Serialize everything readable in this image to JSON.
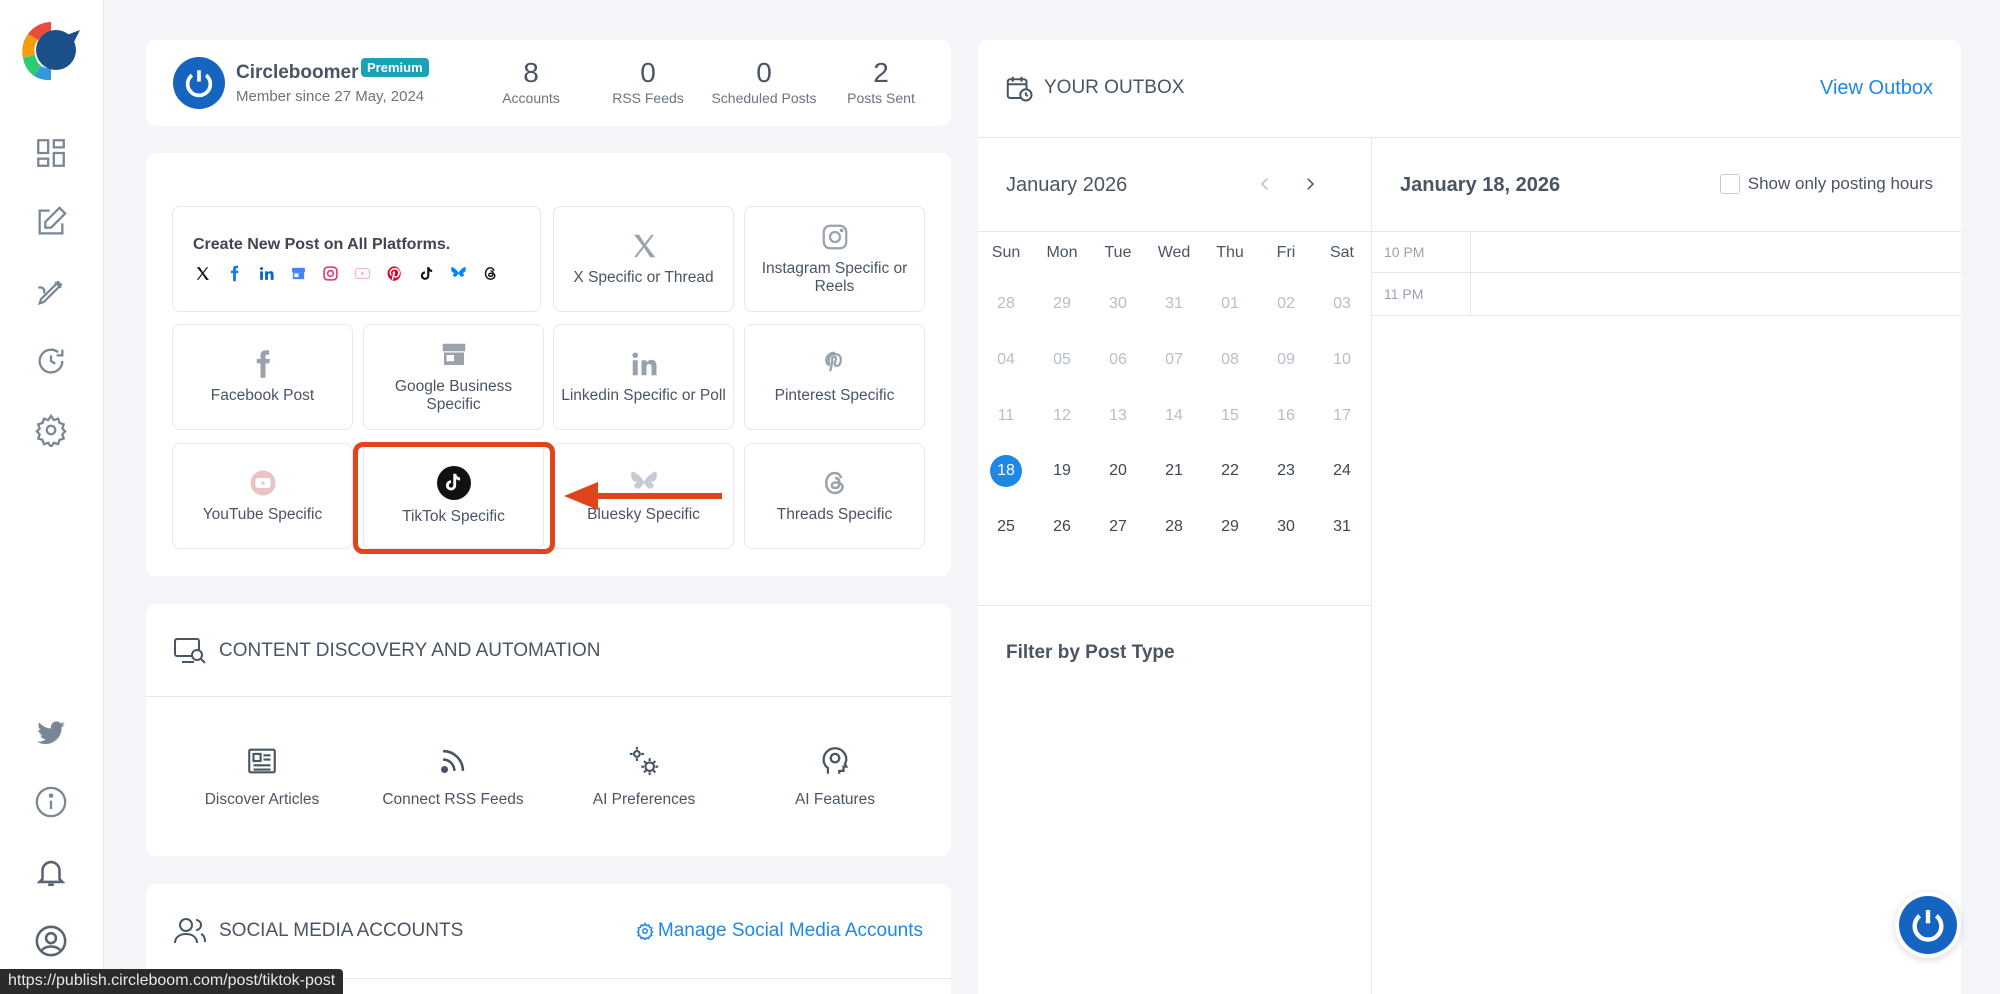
{
  "sidebar": {
    "icons": [
      "dashboard-icon",
      "edit-post-icon",
      "compose-icon",
      "schedule-icon",
      "settings-icon",
      "twitter-icon",
      "info-icon",
      "bell-icon",
      "user-circle-icon"
    ]
  },
  "profile": {
    "name": "Circleboomer",
    "badge": "Premium",
    "member_since": "Member since 27 May, 2024",
    "stats": [
      {
        "num": "8",
        "label": "Accounts"
      },
      {
        "num": "0",
        "label": "RSS Feeds"
      },
      {
        "num": "0",
        "label": "Scheduled Posts"
      },
      {
        "num": "2",
        "label": "Posts Sent"
      }
    ]
  },
  "create": {
    "all_title": "Create New Post on All Platforms.",
    "tiles": {
      "x": "X Specific or Thread",
      "instagram": "Instagram Specific or Reels",
      "facebook": "Facebook Post",
      "google": "Google Business Specific",
      "linkedin": "Linkedin Specific or Poll",
      "pinterest": "Pinterest Specific",
      "youtube": "YouTube Specific",
      "tiktok": "TikTok Specific",
      "bluesky": "Bluesky Specific",
      "threads": "Threads Specific"
    }
  },
  "discovery": {
    "title": "CONTENT DISCOVERY AND AUTOMATION",
    "items": [
      "Discover Articles",
      "Connect RSS Feeds",
      "AI Preferences",
      "AI Features"
    ]
  },
  "social": {
    "title": "SOCIAL MEDIA ACCOUNTS",
    "manage": "Manage Social Media Accounts"
  },
  "statusbar": "https://publish.circleboom.com/post/tiktok-post",
  "outbox": {
    "title": "YOUR OUTBOX",
    "view": "View Outbox",
    "month": "January 2026",
    "weekdays": [
      "Sun",
      "Mon",
      "Tue",
      "Wed",
      "Thu",
      "Fri",
      "Sat"
    ],
    "weeks": [
      [
        {
          "d": "28",
          "m": true
        },
        {
          "d": "29",
          "m": true
        },
        {
          "d": "30",
          "m": true
        },
        {
          "d": "31",
          "m": true
        },
        {
          "d": "01",
          "m": true
        },
        {
          "d": "02",
          "m": true
        },
        {
          "d": "03",
          "m": true
        }
      ],
      [
        {
          "d": "04",
          "m": true
        },
        {
          "d": "05",
          "m": true
        },
        {
          "d": "06",
          "m": true
        },
        {
          "d": "07",
          "m": true
        },
        {
          "d": "08",
          "m": true
        },
        {
          "d": "09",
          "m": true
        },
        {
          "d": "10",
          "m": true
        }
      ],
      [
        {
          "d": "11",
          "m": true
        },
        {
          "d": "12",
          "m": true
        },
        {
          "d": "13",
          "m": true
        },
        {
          "d": "14",
          "m": true
        },
        {
          "d": "15",
          "m": true
        },
        {
          "d": "16",
          "m": true
        },
        {
          "d": "17",
          "m": true
        }
      ],
      [
        {
          "d": "18",
          "m": false,
          "sel": true
        },
        {
          "d": "19",
          "m": false
        },
        {
          "d": "20",
          "m": false
        },
        {
          "d": "21",
          "m": false
        },
        {
          "d": "22",
          "m": false
        },
        {
          "d": "23",
          "m": false
        },
        {
          "d": "24",
          "m": false
        }
      ],
      [
        {
          "d": "25",
          "m": false
        },
        {
          "d": "26",
          "m": false
        },
        {
          "d": "27",
          "m": false
        },
        {
          "d": "28",
          "m": false
        },
        {
          "d": "29",
          "m": false
        },
        {
          "d": "30",
          "m": false
        },
        {
          "d": "31",
          "m": false
        }
      ]
    ],
    "filter": "Filter by Post Type",
    "day_title": "January 18, 2026",
    "posting_hours": "Show only posting hours",
    "slots": [
      "10 PM",
      "11 PM"
    ]
  }
}
